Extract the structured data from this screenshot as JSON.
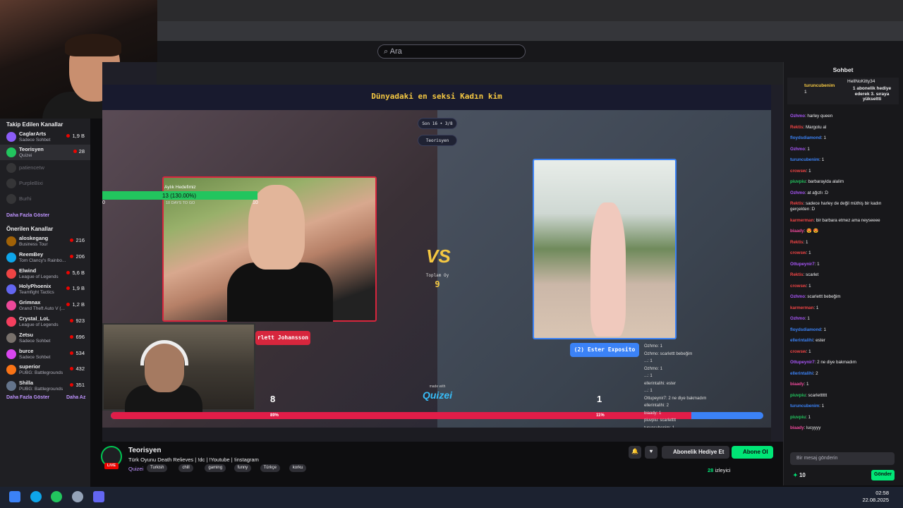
{
  "browser": {
    "search_placeholder": "Ara"
  },
  "sidebar": {
    "followed_title": "Takip Edilen Kanallar",
    "followed": [
      {
        "name": "CaglarArts",
        "game": "Sadece Sohbet",
        "viewers": "1,9 B",
        "color": "#8b5cf6"
      },
      {
        "name": "Teorisyen",
        "game": "Quizei",
        "viewers": "28",
        "color": "#22c55e",
        "selected": true
      },
      {
        "name": "patiencetw",
        "offline": true
      },
      {
        "name": "PurpleBixi",
        "offline": true
      },
      {
        "name": "Burhi",
        "offline": true
      }
    ],
    "show_more_1": "Daha Fazla Göster",
    "recommended_title": "Önerilen Kanallar",
    "recommended": [
      {
        "name": "aloskegang",
        "game": "Business Tour",
        "viewers": "216",
        "color": "#a16207"
      },
      {
        "name": "ReemBey",
        "game": "Tom Clancy's Rainbo...",
        "viewers": "206",
        "color": "#0ea5e9"
      },
      {
        "name": "Elwind",
        "game": "League of Legends",
        "viewers": "5,6 B",
        "color": "#ef4444"
      },
      {
        "name": "HolyPhoenix",
        "game": "Teamfight Tactics",
        "viewers": "1,9 B",
        "color": "#6366f1"
      },
      {
        "name": "Grimnax",
        "game": "Grand Theft Auto V (...",
        "viewers": "1,2 B",
        "color": "#ec4899"
      },
      {
        "name": "Crystal_LoL",
        "game": "League of Legends",
        "viewers": "923",
        "color": "#f43f5e"
      },
      {
        "name": "Zetsu",
        "game": "Sadece Sohbet",
        "viewers": "696",
        "color": "#78716c"
      },
      {
        "name": "burce",
        "game": "Sadece Sohbet",
        "viewers": "534",
        "color": "#d946ef"
      },
      {
        "name": "superior",
        "game": "PUBG: Battlegrounds",
        "viewers": "432",
        "color": "#f97316"
      },
      {
        "name": "Shilla",
        "game": "PUBG: Battlegrounds",
        "viewers": "351",
        "color": "#64748b"
      }
    ],
    "show_more_2": "Daha Fazla Göster",
    "show_less": "Daha Az"
  },
  "quiz": {
    "title": "Dünyadaki en seksi Kadın kim",
    "round_chip": "Son 16 • 3/8",
    "streamer_chip": "Teorisyen",
    "left_name": "Scarlett Johansson",
    "left_name_visible": "rlett Johansson",
    "right_name": "(2) Ester Exposito",
    "vs": "VS",
    "total_label": "Toplam Oy",
    "total_value": "9",
    "left_score": "8",
    "right_score": "1",
    "left_pct_label": "89%",
    "right_pct_label": "11%",
    "left_pct": 89,
    "made_with": "made with",
    "made_logo": "Quizei"
  },
  "goal": {
    "label": "Aylık Hedefimiz",
    "value": "13 (130.00%)",
    "days": "10 DAYS TO GO",
    "low": "0",
    "high": "10",
    "progress": 1.0
  },
  "overlay_chat": [
    "Ozhmo: 1",
    "Ozhmo: scarlettt bebeğim",
    "...: 1",
    "Ozhmo: 1",
    "...: 1",
    "ellerintalihi: ester",
    "...: 1",
    "Ottupeynir7: 2 ne diye bakmadım",
    "ellerintalihi: 2",
    "biaady: 1",
    "piuvpiu: scarletttt",
    "turuncubenim: 1"
  ],
  "channel": {
    "name": "Teorisyen",
    "live": "LIVE",
    "title": "Türk Oyunu Death Relieves  | !dc | !Youtube | !instagram",
    "game": "Quizei",
    "tags": [
      "Turkish",
      "chill",
      "gaming",
      "funny",
      "Türkçe",
      "korku"
    ],
    "subscribe": "Abonelik Hediye Et",
    "follow": "Abone Ol",
    "viewers": "28",
    "viewers_label": "izleyici"
  },
  "chat": {
    "title": "Sohbet",
    "pinned_user": "turuncubenim",
    "pinned_count": "1",
    "pinned_gifter": "HellNoKitty34",
    "pinned_text": "1 abonelik hediye ederek 3. sıraya yükseltti",
    "messages": [
      {
        "user": "Ozhmo",
        "color": "#a855f7",
        "text": ": harley queen"
      },
      {
        "user": "Rektis",
        "color": "#ef4444",
        "text": ": Margotu al"
      },
      {
        "user": "floydsdiamond",
        "color": "#3b82f6",
        "text": ": 1"
      },
      {
        "user": "Ozhmo",
        "color": "#a855f7",
        "text": ": 1"
      },
      {
        "user": "turuncubenim",
        "color": "#3b82f6",
        "text": ": 1"
      },
      {
        "user": "crowsw",
        "color": "#ef4444",
        "text": ": 1"
      },
      {
        "user": "piuvpiu",
        "color": "#22c55e",
        "text": ": barbarayida alalim"
      },
      {
        "user": "Ozhmo",
        "color": "#a855f7",
        "text": ": at ağızlı :D"
      },
      {
        "user": "Rektis",
        "color": "#ef4444",
        "text": ": sadece harley de değil müthiş bir kadın gerçekten :D"
      },
      {
        "user": "karmerman",
        "color": "#ef4444",
        "text": ": bir barbara etmez ama neyseeee"
      },
      {
        "user": "biaady",
        "color": "#ec4899",
        "text": ": 😍 😍"
      },
      {
        "user": "Rektis",
        "color": "#ef4444",
        "text": ": 1"
      },
      {
        "user": "crowsw",
        "color": "#ef4444",
        "text": ": 1"
      },
      {
        "user": "Ottupeynir7",
        "color": "#a855f7",
        "text": ": 1"
      },
      {
        "user": "Rektis",
        "color": "#ef4444",
        "text": ": scarlet"
      },
      {
        "user": "crowsw",
        "color": "#ef4444",
        "text": ": 1"
      },
      {
        "user": "Ozhmo",
        "color": "#a855f7",
        "text": ": scarlettt bebeğim"
      },
      {
        "user": "karmerman",
        "color": "#ef4444",
        "text": ": 1"
      },
      {
        "user": "Ozhmo",
        "color": "#a855f7",
        "text": ": 1"
      },
      {
        "user": "floydsdiamond",
        "color": "#3b82f6",
        "text": ": 1"
      },
      {
        "user": "ellerintalihi",
        "color": "#3b82f6",
        "text": ": ester"
      },
      {
        "user": "crowsw",
        "color": "#ef4444",
        "text": ": 1"
      },
      {
        "user": "Ottupeynir7",
        "color": "#a855f7",
        "text": ": 2 ne diye bakmadım"
      },
      {
        "user": "ellerintalihi",
        "color": "#3b82f6",
        "text": ": 2"
      },
      {
        "user": "biaady",
        "color": "#ec4899",
        "text": ": 1"
      },
      {
        "user": "piuvpiu",
        "color": "#22c55e",
        "text": ": scarletttttt"
      },
      {
        "user": "turuncubenim",
        "color": "#3b82f6",
        "text": ": 1"
      },
      {
        "user": "piuvpiu",
        "color": "#22c55e",
        "text": ": 1"
      },
      {
        "user": "biaady",
        "color": "#ec4899",
        "text": ": lucyyyy"
      }
    ],
    "input_placeholder": "Bir mesaj gönderin",
    "points": "10",
    "send": "Gönder"
  },
  "taskbar": {
    "time": "02:58",
    "date": "22.08.2025"
  }
}
